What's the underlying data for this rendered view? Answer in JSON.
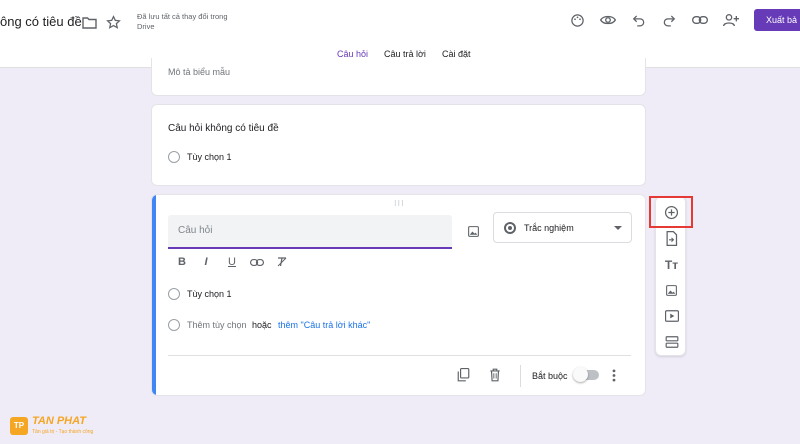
{
  "header": {
    "form_title": "ông có tiêu đề",
    "save_status": "Đã lưu tất cả thay đổi trong Drive",
    "publish_label": "Xuất bả",
    "icons": [
      "folder-icon",
      "star-icon",
      "palette-icon",
      "eye-icon",
      "undo-icon",
      "redo-icon",
      "link-icon",
      "add-person-icon"
    ]
  },
  "tabs": [
    {
      "label": "Câu hỏi",
      "active": true
    },
    {
      "label": "Câu trả lời",
      "active": false
    },
    {
      "label": "Cài đặt",
      "active": false
    }
  ],
  "form": {
    "description_placeholder": "Mô tả biểu mẫu"
  },
  "question1": {
    "title": "Câu hỏi không có tiêu đề",
    "option1": "Tùy chọn 1"
  },
  "question2": {
    "placeholder": "Câu hỏi",
    "type_label": "Trắc nghiệm",
    "option1": "Tùy chọn 1",
    "add_option": "Thêm tùy chọn",
    "or_text": "hoặc",
    "add_other": "thêm \"Câu trả lời khác\"",
    "required_label": "Bắt buộc",
    "required": false
  },
  "format_toolbar": {
    "bold": "B",
    "italic": "I",
    "underline": "U"
  },
  "side_toolbar": {
    "title_icon_text": "Tт"
  },
  "brand": {
    "mark": "TP",
    "name": "TAN PHAT",
    "tagline": "Tân giá trị - Tạo thành công"
  },
  "colors": {
    "accent": "#673ab7",
    "active_border": "#4285f4",
    "link": "#1a73e8",
    "highlight": "#e53935",
    "background": "#efebf7"
  }
}
